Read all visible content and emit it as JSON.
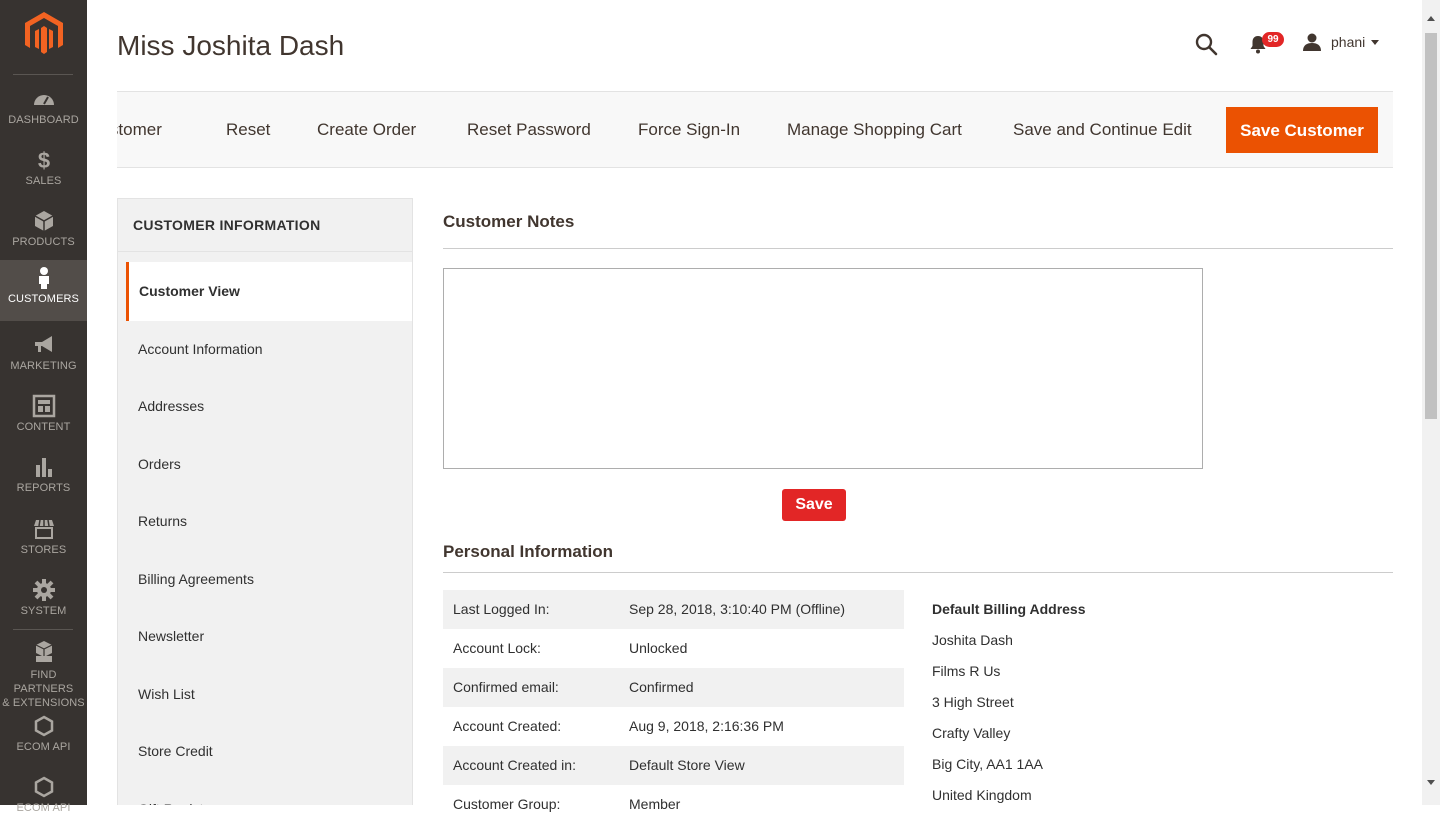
{
  "menu": {
    "items": [
      {
        "label": "DASHBOARD",
        "icon": "dashboard-icon"
      },
      {
        "label": "SALES",
        "icon": "dollar-icon"
      },
      {
        "label": "PRODUCTS",
        "icon": "box-icon"
      },
      {
        "label": "CUSTOMERS",
        "icon": "person-icon"
      },
      {
        "label": "MARKETING",
        "icon": "megaphone-icon"
      },
      {
        "label": "CONTENT",
        "icon": "layout-icon"
      },
      {
        "label": "REPORTS",
        "icon": "bar-chart-icon"
      },
      {
        "label": "STORES",
        "icon": "store-icon"
      },
      {
        "label": "SYSTEM",
        "icon": "gear-icon"
      }
    ],
    "extra": [
      {
        "label1": "FIND PARTNERS",
        "label2": "& EXTENSIONS",
        "icon": "cubes-icon"
      },
      {
        "label": "ECOM API",
        "icon": "hexagon-icon"
      },
      {
        "label": "ECOM API",
        "icon": "hexagon-icon"
      }
    ],
    "active_index": 3
  },
  "header": {
    "title": "Miss Joshita Dash",
    "notifications_count": "99",
    "user": "phani"
  },
  "actions": {
    "delete_partial": "e Customer",
    "reset": "Reset",
    "create_order": "Create Order",
    "reset_password": "Reset Password",
    "force_signin": "Force Sign-In",
    "manage_cart": "Manage Shopping Cart",
    "save_continue": "Save and Continue Edit",
    "save_customer": "Save Customer"
  },
  "tabs": {
    "title": "CUSTOMER INFORMATION",
    "items": [
      "Customer View",
      "Account Information",
      "Addresses",
      "Orders",
      "Returns",
      "Billing Agreements",
      "Newsletter",
      "Wish List",
      "Store Credit",
      "Gift Registry"
    ]
  },
  "notes": {
    "title": "Customer Notes",
    "value": "",
    "save_label": "Save"
  },
  "personal": {
    "title": "Personal Information",
    "rows": [
      {
        "label": "Last Logged In:",
        "value": "Sep 28, 2018, 3:10:40 PM (Offline)"
      },
      {
        "label": "Account Lock:",
        "value": "Unlocked"
      },
      {
        "label": "Confirmed email:",
        "value": "Confirmed"
      },
      {
        "label": "Account Created:",
        "value": "Aug 9, 2018, 2:16:36 PM"
      },
      {
        "label": "Account Created in:",
        "value": "Default Store View"
      },
      {
        "label": "Customer Group:",
        "value": "Member"
      }
    ],
    "billing": {
      "title": "Default Billing Address",
      "lines": [
        "Joshita Dash",
        "Films R Us",
        "3 High Street",
        "Crafty Valley",
        "Big City, AA1 1AA",
        "United Kingdom"
      ]
    }
  },
  "colors": {
    "menu_bg": "#373330",
    "menu_active": "#524d49",
    "accent": "#eb5202",
    "save_red": "#e22626"
  }
}
